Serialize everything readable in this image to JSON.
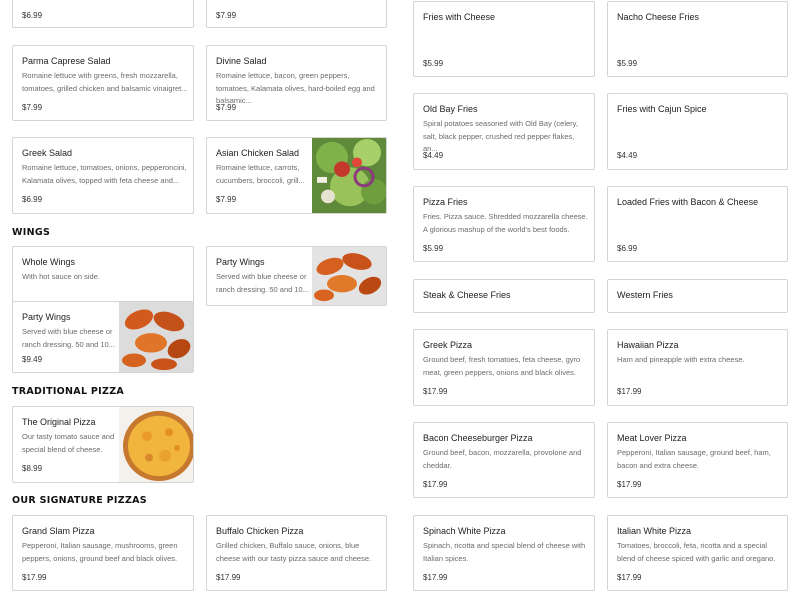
{
  "left": {
    "top_partial": [
      {
        "price": "$6.99"
      },
      {
        "price": "$7.99"
      }
    ],
    "salads": [
      {
        "name": "Parma Caprese Salad",
        "desc": "Romaine lettuce with greens, fresh mozzarella, tomatoes, grilled chicken and balsamic vinaigret...",
        "price": "$7.99"
      },
      {
        "name": "Divine Salad",
        "desc": "Romaine lettuce, bacon, green peppers, tomatoes, Kalamata olives, hard-boiled egg and balsamic...",
        "price": "$7.99"
      },
      {
        "name": "Greek Salad",
        "desc": "Romaine lettuce, tomatoes, onions, pepperoncini, Kalamata olives, topped with feta cheese and...",
        "price": "$6.99"
      },
      {
        "name": "Asian Chicken Salad",
        "desc": "Romaine lettuce, carrots, cucumbers, broccoli, grill...",
        "price": "$7.99",
        "image": "salad-photo"
      }
    ],
    "wings_title": "WINGS",
    "wings": [
      {
        "name": "Whole Wings",
        "desc": "With hot sauce on side.",
        "price": ""
      },
      {
        "name": "Party Wings",
        "desc": "Served with blue cheese or ranch dressing. 50 and 10...",
        "price": "",
        "image": "wings-photo"
      },
      {
        "name": "Party Wings",
        "desc": "Served with blue cheese or ranch dressing. 50 and 10...",
        "price": "$9.49",
        "image": "wings-photo"
      }
    ],
    "trad_title": "TRADITIONAL PIZZA",
    "trad": [
      {
        "name": "The Original Pizza",
        "desc": "Our tasty tomato sauce and special blend of cheese.",
        "price": "$8.99",
        "image": "pizza-photo"
      }
    ],
    "sig_title": "OUR SIGNATURE PIZZAS",
    "signature": [
      {
        "name": "Grand Slam Pizza",
        "desc": "Pepperoni, Italian sausage, mushrooms, green peppers, onions, ground beef and black olives.",
        "price": "$17.99"
      },
      {
        "name": "Buffalo Chicken Pizza",
        "desc": "Grilled chicken, Buffalo sauce, onions, blue cheese with our tasty pizza sauce and cheese.",
        "price": "$17.99"
      }
    ]
  },
  "right": {
    "fries": [
      {
        "name": "Fries with Cheese",
        "desc": "",
        "price": "$5.99"
      },
      {
        "name": "Nacho Cheese Fries",
        "desc": "",
        "price": "$5.99"
      },
      {
        "name": "Old Bay Fries",
        "desc": "Spiral potatoes seasoned with Old Bay (celery, salt, black pepper, crushed red pepper flakes, an...",
        "price": "$4.49"
      },
      {
        "name": "Fries with Cajun Spice",
        "desc": "",
        "price": "$4.49"
      },
      {
        "name": "Pizza Fries",
        "desc": "Fries. Pizza sauce. Shredded mozzarella cheese. A glorious mashup of the world's best foods.",
        "price": "$5.99"
      },
      {
        "name": "Loaded Fries with Bacon & Cheese",
        "desc": "",
        "price": "$6.99"
      },
      {
        "name": "Steak & Cheese Fries",
        "desc": "",
        "price": ""
      },
      {
        "name": "Western Fries",
        "desc": "",
        "price": ""
      }
    ],
    "pizzas": [
      {
        "name": "Greek Pizza",
        "desc": "Ground beef, fresh tomatoes, feta cheese, gyro meat, green peppers, onions and black olives.",
        "price": "$17.99"
      },
      {
        "name": "Hawaiian Pizza",
        "desc": "Ham and pineapple with extra cheese.",
        "price": "$17.99"
      },
      {
        "name": "Bacon Cheeseburger Pizza",
        "desc": "Ground beef, bacon, mozzarella, provolone and cheddar.",
        "price": "$17.99"
      },
      {
        "name": "Meat Lover Pizza",
        "desc": "Pepperoni, Italian sausage, ground beef, ham, bacon and extra cheese.",
        "price": "$17.99"
      },
      {
        "name": "Spinach White Pizza",
        "desc": "Spinach, ricotta and special blend of cheese with Italian spices.",
        "price": "$17.99"
      },
      {
        "name": "Italian White Pizza",
        "desc": "Tomatoes, broccoli, feta, ricotta and a special blend of cheese spiced with garlic and oregano.",
        "price": "$17.99"
      }
    ]
  }
}
